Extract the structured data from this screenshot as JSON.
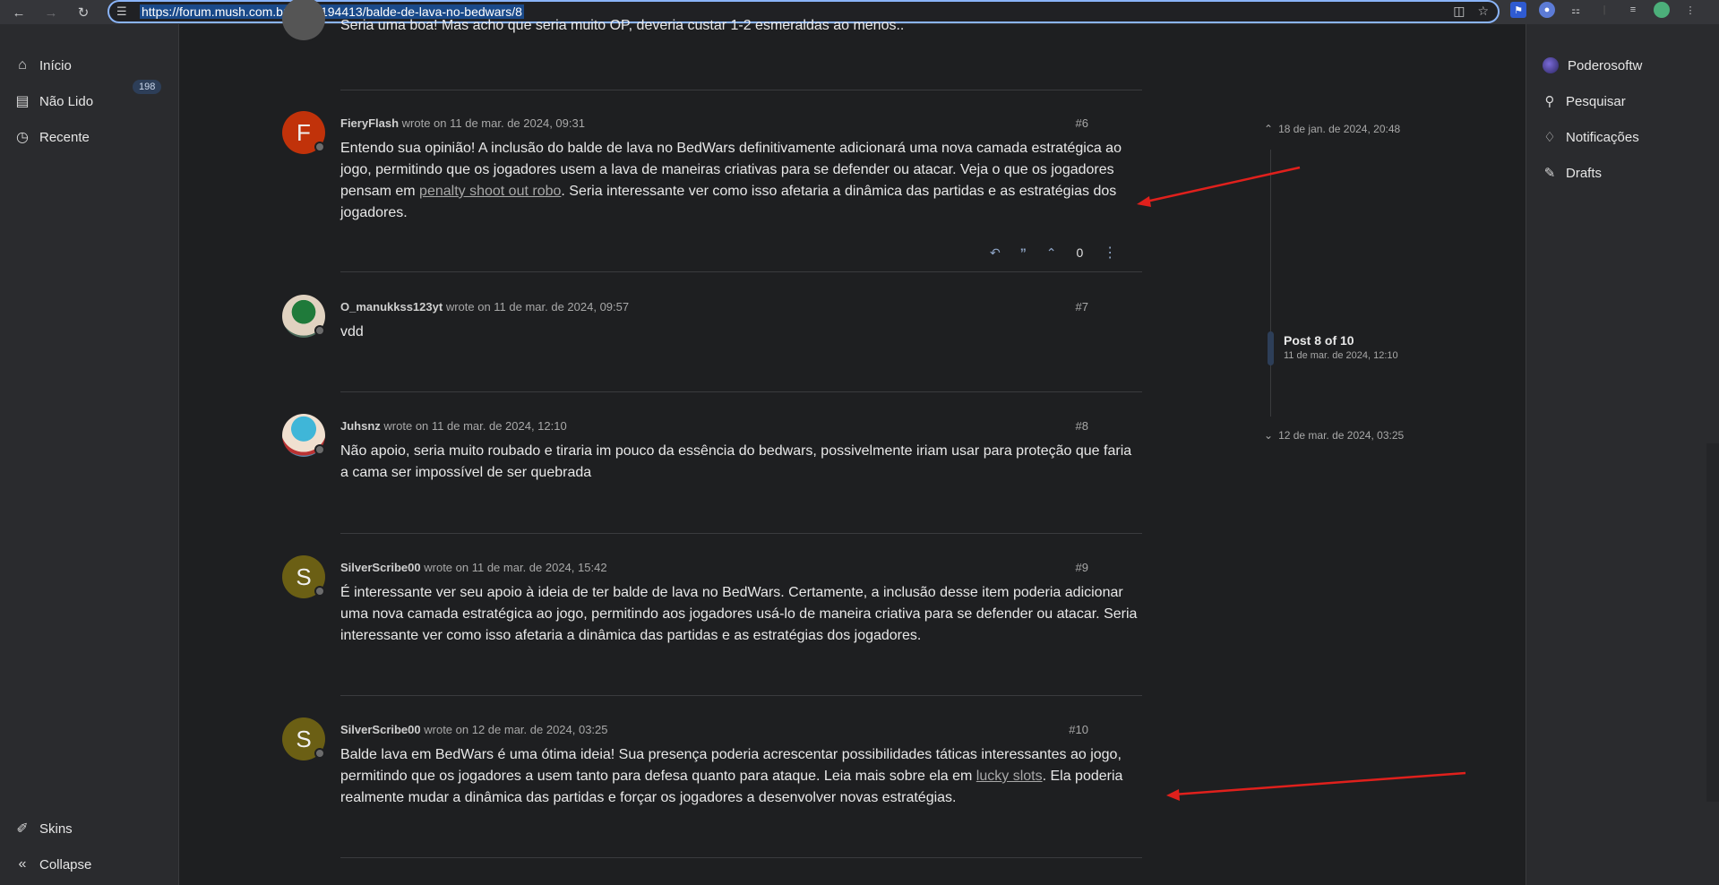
{
  "browser": {
    "url": "https://forum.mush.com.br/topic/194413/balde-de-lava-no-bedwars/8"
  },
  "left_sidebar": {
    "items": [
      {
        "label": "Início",
        "icon": "home-icon"
      },
      {
        "label": "Não Lido",
        "icon": "inbox-icon",
        "badge": "198"
      },
      {
        "label": "Recente",
        "icon": "clock-icon"
      }
    ],
    "bottom": [
      {
        "label": "Skins",
        "icon": "brush-icon"
      },
      {
        "label": "Collapse",
        "icon": "double-chevron-left-icon"
      }
    ]
  },
  "right_sidebar": {
    "items": [
      {
        "label": "Poderosoftw",
        "icon": "avatar"
      },
      {
        "label": "Pesquisar",
        "icon": "search-icon"
      },
      {
        "label": "Notificações",
        "icon": "bell-icon"
      },
      {
        "label": "Drafts",
        "icon": "edit-icon"
      }
    ]
  },
  "partial_post": {
    "text": "Seria uma boa! Mas acho que seria muito OP, deveria custar 1-2 esmeraldas ao menos.."
  },
  "posts": [
    {
      "avatar_letter": "F",
      "avatar_color": "#c1320a",
      "author": "FieryFlash",
      "wrote": "wrote on 11 de mar. de 2024, 09:31",
      "number": "#6",
      "text_before": "Entendo sua opinião! A inclusão do balde de lava no BedWars definitivamente adicionará uma nova camada estratégica ao jogo, permitindo que os jogadores usem a lava de maneiras criativas para se defender ou atacar. Veja o que os jogadores pensam em ",
      "link": "penalty shoot out robo",
      "text_after": ". Seria interessante ver como isso afetaria a dinâmica das partidas e as estratégias dos jogadores."
    },
    {
      "avatar_letter": "",
      "avatar_color": "#4a6a5a",
      "author": "O_manukkss123yt",
      "wrote": "wrote on 11 de mar. de 2024, 09:57",
      "number": "#7",
      "text": "vdd"
    },
    {
      "avatar_letter": "",
      "avatar_color": "#5a86a8",
      "author": "Juhsnz",
      "wrote": "wrote on 11 de mar. de 2024, 12:10",
      "number": "#8",
      "text": "Não apoio, seria muito roubado e tiraria im pouco da essência do bedwars, possivelmente iriam usar para proteção que faria a cama ser impossível de ser quebrada"
    },
    {
      "avatar_letter": "S",
      "avatar_color": "#6b5f14",
      "author": "SilverScribe00",
      "wrote": "wrote on 11 de mar. de 2024, 15:42",
      "number": "#9",
      "text": "É interessante ver seu apoio à ideia de ter balde de lava no BedWars. Certamente, a inclusão desse item poderia adicionar uma nova camada estratégica ao jogo, permitindo aos jogadores usá-lo de maneira criativa para se defender ou atacar. Seria interessante ver como isso afetaria a dinâmica das partidas e as estratégias dos jogadores."
    },
    {
      "avatar_letter": "S",
      "avatar_color": "#6b5f14",
      "author": "SilverScribe00",
      "wrote": "wrote on 12 de mar. de 2024, 03:25",
      "number": "#10",
      "text_before": "Balde lava em BedWars é uma ótima ideia! Sua presença poderia acrescentar possibilidades táticas interessantes ao jogo, permitindo que os jogadores a usem tanto para defesa quanto para ataque. Leia mais sobre ela em ",
      "link": "lucky slots",
      "text_after": ". Ela poderia realmente mudar a dinâmica das partidas e forçar os jogadores a desenvolver novas estratégias."
    }
  ],
  "post_actions": {
    "vote_count": "0"
  },
  "timeline": {
    "top_date": "18 de jan. de 2024, 20:48",
    "position": "Post 8 of 10",
    "position_date": "11 de mar. de 2024, 12:10",
    "bottom_date": "12 de mar. de 2024, 03:25"
  },
  "colors": {
    "annotation_arrow": "#e0201c",
    "accent": "#2d3e58"
  }
}
